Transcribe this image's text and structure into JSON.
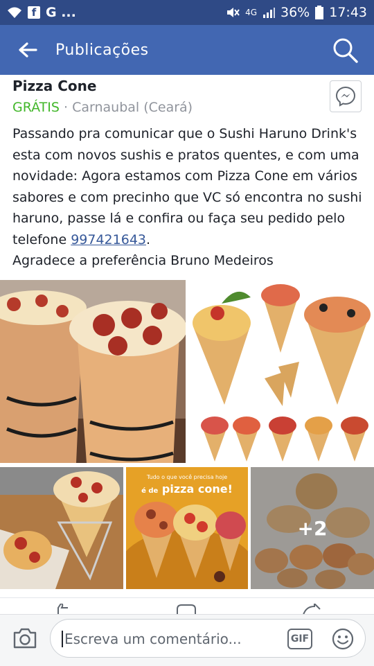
{
  "status_bar": {
    "left_icons": [
      "wifi-icon",
      "facebook-icon",
      "google-icon"
    ],
    "left_text": "G ...",
    "network": "4G",
    "battery": "36%",
    "time": "17:43"
  },
  "header": {
    "title": "Publicações",
    "back_icon": "arrow-left-icon",
    "search_icon": "search-icon"
  },
  "post": {
    "title": "Pizza Cone",
    "price": "GRÁTIS",
    "separator": " · ",
    "location": "Carnaubal (Ceará)",
    "body_lines": [
      "Passando pra comunicar que o Sushi Haruno Drink's",
      "esta com novos sushis e pratos quentes, e com uma",
      "novidade: Agora estamos com Pizza Cone em vários",
      "sabores e com precinho que VC só encontra no sushi",
      "haruno, passe lá e confira ou faça seu pedido pelo"
    ],
    "phone_prefix": "telefone ",
    "phone": "997421643",
    "phone_suffix": ".",
    "closing": "Agradece a preferência Bruno Medeiros"
  },
  "photos": {
    "promo_line1": "Tudo o que você precisa hoje",
    "promo_line2": "é de",
    "promo_line3": "pizza cone!",
    "more_count": "+2"
  },
  "comment": {
    "placeholder": "Escreva um comentário...",
    "gif_label": "GIF"
  },
  "colors": {
    "brand": "#4267b2",
    "status": "#2f4a86",
    "free_green": "#42b72a",
    "link": "#365899"
  }
}
